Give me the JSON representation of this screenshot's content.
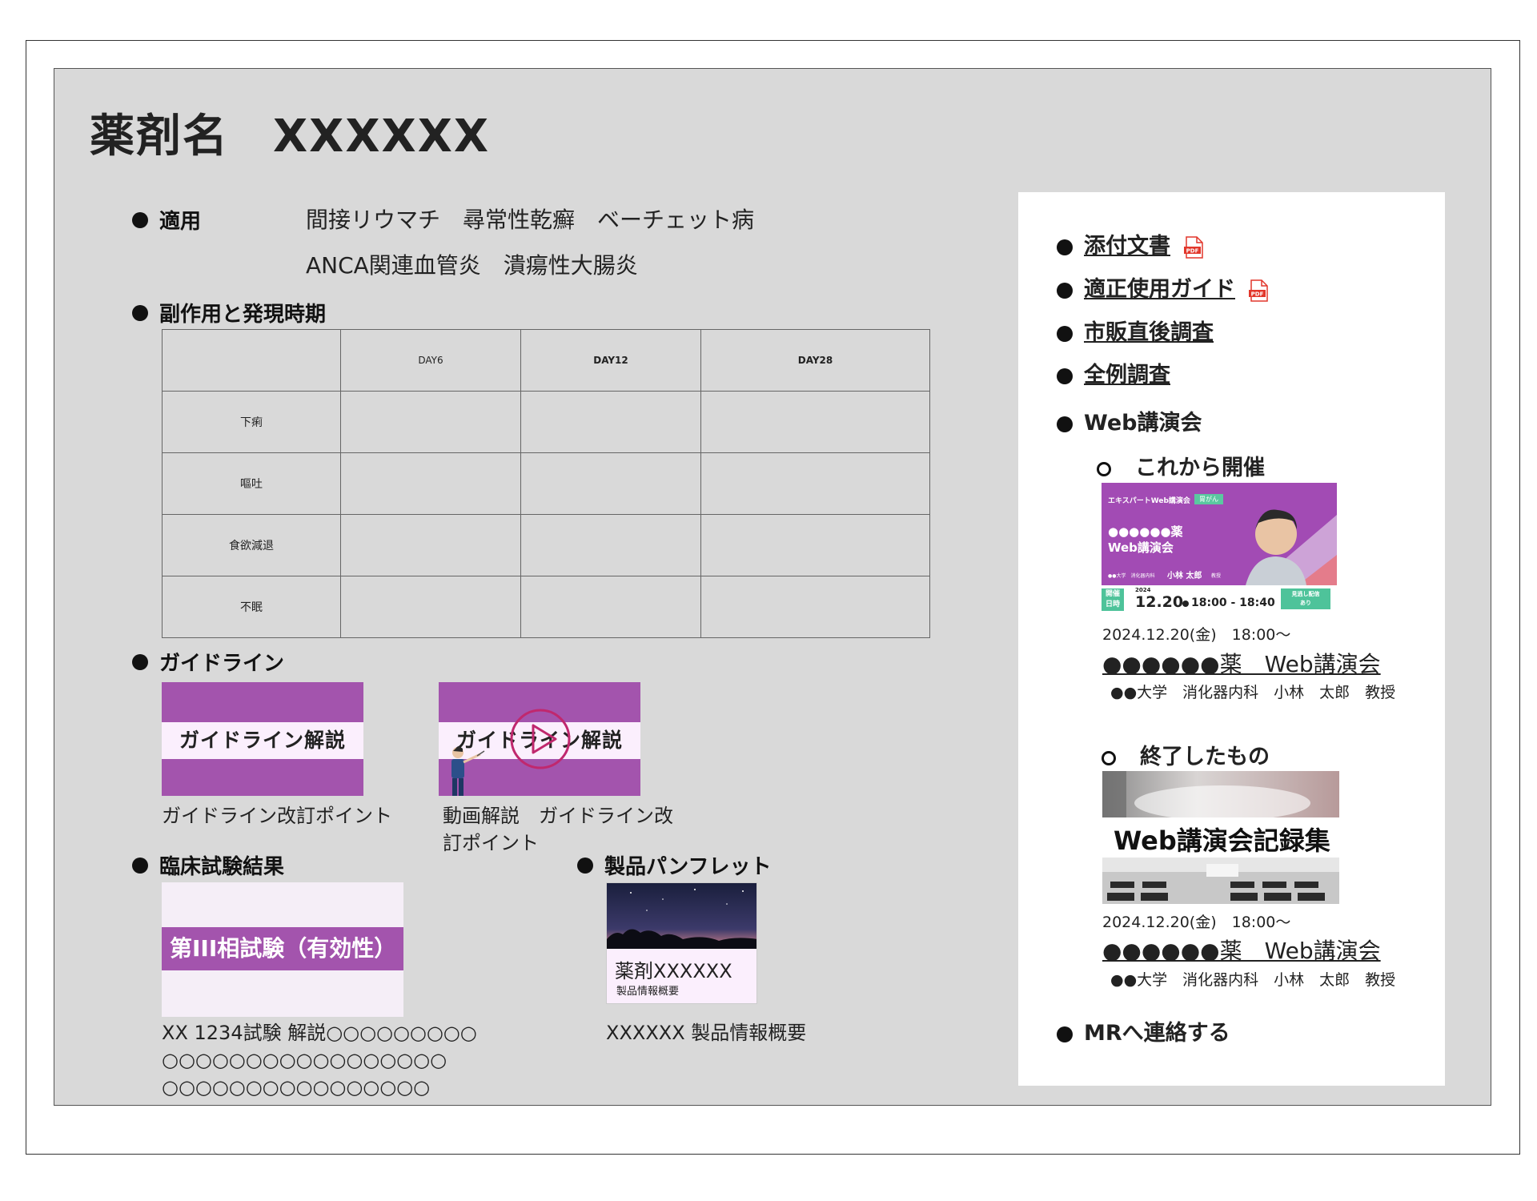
{
  "page": {
    "title_prefix": "薬剤名",
    "title_value": "XXXXXX"
  },
  "indication": {
    "label": "適用",
    "line1": "間接リウマチ　尋常性乾癬　ベーチェット病",
    "line2": "ANCA関連血管炎　潰瘍性大腸炎"
  },
  "side_effects": {
    "label": "副作用と発現時期",
    "columns": [
      "",
      "DAY6",
      "DAY12",
      "DAY28"
    ],
    "rows": [
      "下痢",
      "嘔吐",
      "食欲減退",
      "不眠"
    ]
  },
  "guideline": {
    "label": "ガイドライン",
    "items": [
      {
        "thumb_text": "ガイドライン解説",
        "caption": "ガイドライン改訂ポイント"
      },
      {
        "thumb_text": "ガイドライン解説",
        "caption_line1": "動画解説　ガイドライン改",
        "caption_line2": "訂ポイント"
      }
    ]
  },
  "clinical": {
    "label": "臨床試験結果",
    "thumb_text": "第III相試験（有効性）",
    "caption_lines": [
      "XX 1234試験 解説○○○○○○○○○",
      "○○○○○○○○○○○○○○○○○",
      "○○○○○○○○○○○○○○○○"
    ]
  },
  "pamphlet": {
    "label": "製品パンフレット",
    "thumb_title": "薬剤XXXXXX",
    "thumb_sub": "製品情報概要",
    "caption": "XXXXXX 製品情報概要"
  },
  "sidebar": {
    "links": [
      {
        "label": "添付文書",
        "pdf": true
      },
      {
        "label": "適正使用ガイド",
        "pdf": true
      },
      {
        "label": "市販直後調査",
        "pdf": false
      },
      {
        "label": "全例調査",
        "pdf": false
      }
    ],
    "pdf_icon_text": "PDF",
    "web_label": "Web講演会",
    "upcoming_label": "これから開催",
    "upcoming_banner": {
      "top_label": "エキスパートWeb講演会",
      "tag": "胃がん",
      "title_line1": "●●●●●●薬",
      "title_line2": "Web講演会",
      "affil": "●●大学　消化器内科",
      "speaker": "小林 太郎",
      "speaker_title": "教授",
      "date_tag_line1": "開催",
      "date_tag_line2": "日時",
      "year": "2024",
      "date_time": "12.20",
      "time_range": "18:00 - 18:40",
      "replay_line1": "見逃し配信",
      "replay_line2": "あり"
    },
    "upcoming_event": {
      "date": "2024.12.20(金)　18:00～",
      "title": "●●●●●●薬　Web講演会",
      "speaker": "●●大学　消化器内科　小林　太郎　教授"
    },
    "past_label": "終了したもの",
    "past_banner_text": "Web講演会記録集",
    "past_event": {
      "date": "2024.12.20(金)　18:00～",
      "title": "●●●●●●薬　Web講演会",
      "speaker": "●●大学　消化器内科　小林　太郎　教授"
    },
    "mr_label": "MRへ連絡する"
  },
  "colors": {
    "panel_bg": "#d9d9d9",
    "accent_purple": "#a354ad",
    "pdf_red": "#e2372b"
  }
}
